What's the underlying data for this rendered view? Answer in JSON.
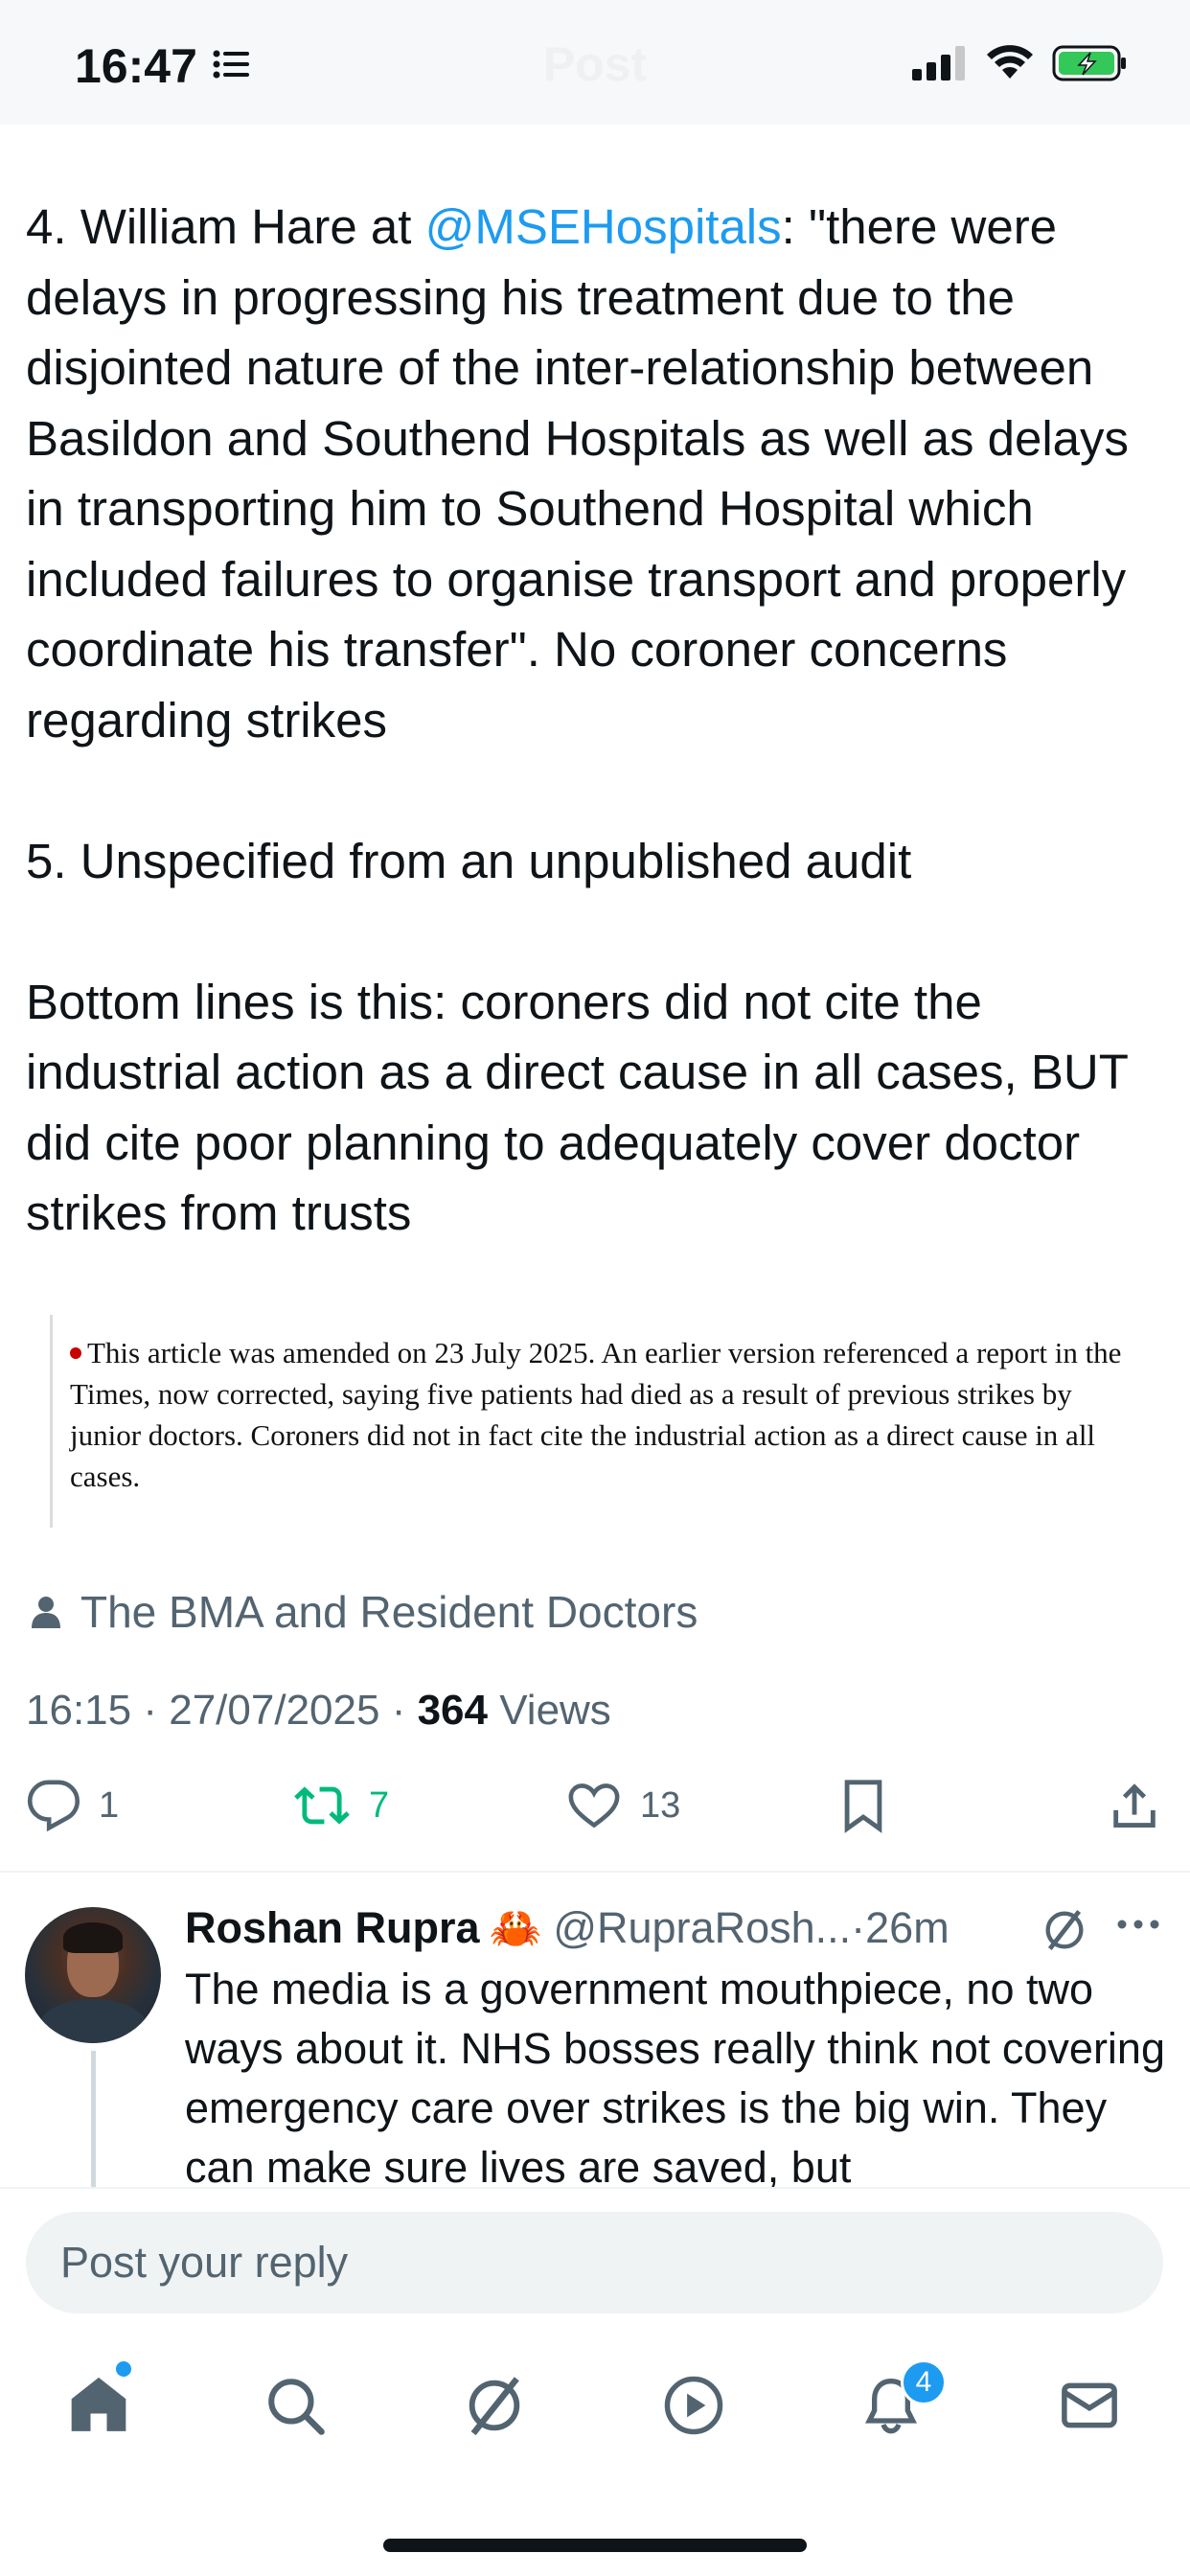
{
  "status_bar": {
    "time": "16:47",
    "ghost_title": "Post"
  },
  "tweet": {
    "text_before_mention": "4. William Hare at ",
    "mention": "@MSEHospitals",
    "text_after_mention": ": \"there were delays in progressing his treatment due to the disjointed nature of the inter-relationship between Basildon and Southend Hospitals as well as delays in transporting him to Southend Hospital which included failures to organise transport and properly coordinate his transfer\". No coroner concerns regarding strikes\n\n5. Unspecified from an unpublished audit\n\nBottom lines is this: coroners did not cite the industrial action as a direct cause in all cases, BUT did cite poor planning to adequately cover doctor strikes from trusts",
    "quoted_image_text": "This article was amended on 23 July 2025. An earlier version referenced a report in the Times, now corrected, saying five patients had died as a result of previous strikes by junior doctors. Coroners did not in fact cite the industrial action as a direct cause in all cases.",
    "community": "The BMA and Resident Doctors",
    "time": "16:15",
    "date": "27/07/2025",
    "views_count": "364",
    "views_label": "Views",
    "sep": "·"
  },
  "actions": {
    "replies": "1",
    "reposts": "7",
    "likes": "13"
  },
  "reply": {
    "name": "Roshan Rupra",
    "emoji": "🦀",
    "handle": "@RupraRosh...",
    "time": "26m",
    "text": "The media is a government mouthpiece, no two ways about it. NHS bosses really think not covering emergency care over strikes is the big win. They can make sure lives are saved, but"
  },
  "composer": {
    "placeholder": "Post your reply"
  },
  "tabbar": {
    "notifications_badge": "4"
  },
  "colors": {
    "accent": "#1d9bf0",
    "repost_green": "#00ba7c",
    "secondary_text": "#536471"
  }
}
